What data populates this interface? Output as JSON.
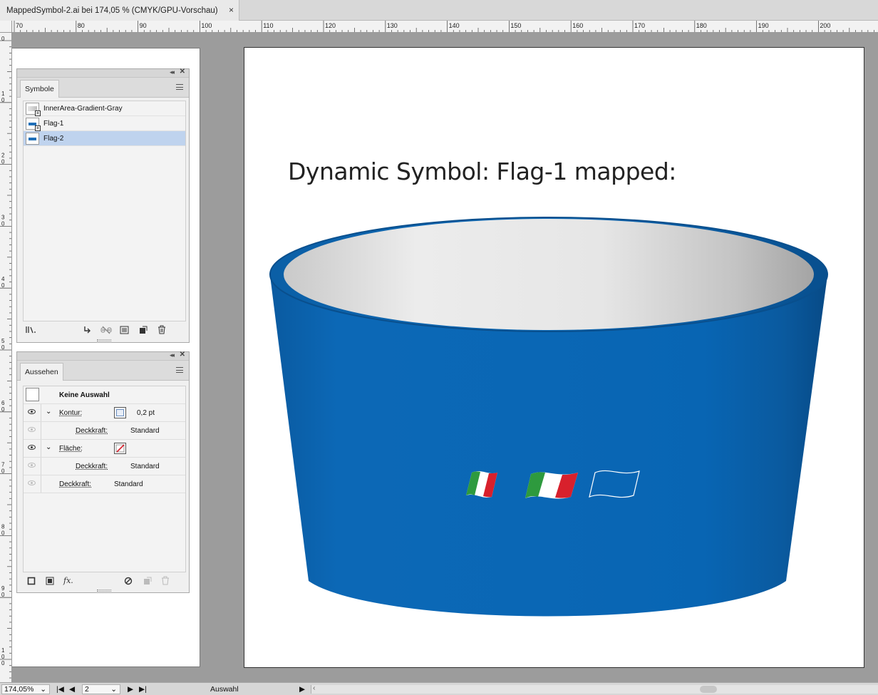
{
  "window": {
    "tab_title": "MappedSymbol-2.ai bei 174,05 % (CMYK/GPU-Vorschau)",
    "close_glyph": "×"
  },
  "rulers": {
    "horizontal_labels": [
      "70",
      "80",
      "90",
      "100",
      "110",
      "120",
      "130",
      "140",
      "150",
      "160",
      "170",
      "180",
      "190",
      "200"
    ],
    "vertical_labels": [
      "0",
      "1 0",
      "2 0",
      "3 0",
      "4 0",
      "5 0",
      "6 0",
      "7 0",
      "8 0",
      "9 0",
      "1 0 0"
    ]
  },
  "symbols_panel": {
    "tab_label": "Symbole",
    "items": [
      {
        "name": "InnerArea-Gradient-Gray",
        "thumb": "gradient",
        "selected": false
      },
      {
        "name": "Flag-1",
        "thumb": "flag",
        "selected": false
      },
      {
        "name": "Flag-2",
        "thumb": "flag",
        "selected": true
      }
    ],
    "bottom_icons": [
      "library-icon",
      "place-symbol-icon",
      "break-link-icon",
      "symbol-options-icon",
      "new-symbol-icon",
      "trash-icon"
    ]
  },
  "appearance_panel": {
    "tab_label": "Aussehen",
    "header": "Keine Auswahl",
    "stroke_label": "Kontur:",
    "stroke_value": "0,2 pt",
    "opacity_label": "Deckkraft:",
    "opacity_value": "Standard",
    "fill_label": "Fläche:",
    "bottom_icons": [
      "add-stroke-icon",
      "add-fill-icon",
      "fx-icon",
      "clear-appearance-icon",
      "duplicate-item-icon",
      "trash-icon"
    ],
    "fx_glyph": "fx."
  },
  "artboard": {
    "heading": "Dynamic Symbol:  Flag-1 mapped:",
    "colors": {
      "bucket_blue": "#0a66b3",
      "flag_green": "#2e9a3e",
      "flag_red": "#d8202c",
      "flag_white": "#ffffff"
    }
  },
  "statusbar": {
    "zoom": "174,05%",
    "artboard_number": "2",
    "tool": "Auswahl"
  }
}
